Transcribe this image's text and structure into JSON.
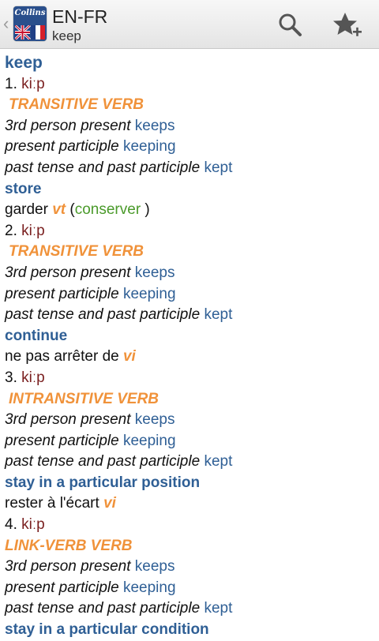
{
  "header": {
    "back_glyph": "‹",
    "logo_text": "Collins",
    "title": "EN-FR",
    "subtitle": "keep",
    "actions": [
      {
        "icon": "search-icon"
      },
      {
        "icon": "star-add-icon"
      }
    ]
  },
  "entry": {
    "headword": "keep",
    "phonetic": "kiːp",
    "forms_labels": {
      "third": "3rd person present",
      "part": "present participle",
      "past": "past tense and past participle"
    },
    "forms_values": {
      "third": "keeps",
      "part": "keeping",
      "past": "kept"
    },
    "senses": [
      {
        "number": "1.",
        "pos": "TRANSITIVE VERB",
        "meaning": "store",
        "translation": "garder",
        "gram": "vt",
        "paren_open": "(",
        "context": "conserver",
        "paren_close": ")"
      },
      {
        "number": "2.",
        "pos": "TRANSITIVE VERB",
        "meaning": "continue",
        "translation": "ne pas arrêter de",
        "gram": "vi"
      },
      {
        "number": "3.",
        "pos": "INTRANSITIVE VERB",
        "meaning": "stay in a particular position",
        "translation": "rester à l'écart",
        "gram": "vi"
      },
      {
        "number": "4.",
        "pos": "LINK-VERB VERB",
        "meaning": "stay in a particular condition"
      }
    ]
  },
  "colors": {
    "headword": "#2f5f95",
    "pos": "#f0923a",
    "phonetic": "#7a1f1f",
    "context": "#4a9a2a"
  }
}
